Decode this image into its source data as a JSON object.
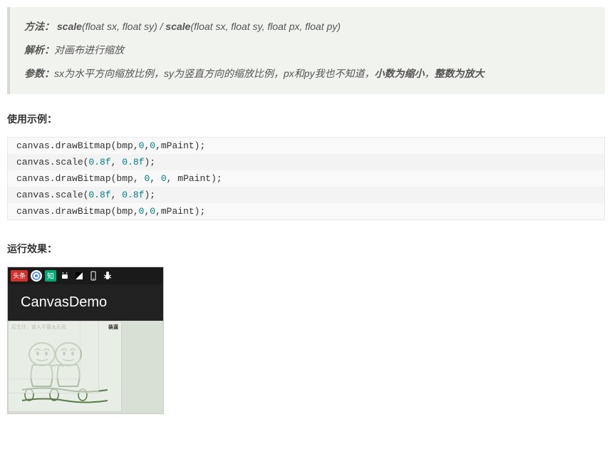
{
  "info_box": {
    "method_label": "方法",
    "method_sig_1": "scale",
    "method_params_1": "(float sx, float sy)",
    "method_separator": " / ",
    "method_sig_2": "scale",
    "method_params_2": "(float sx, float sy, float px, float py)",
    "analysis_label": "解析",
    "analysis_text": "对画布进行缩放",
    "params_label": "参数",
    "params_text": "sx为水平方向缩放比例，sy为竖直方向的缩放比例，px和py我也不知道，",
    "params_bold_1": "小数为缩小",
    "params_sep": "，",
    "params_bold_2": "整数为放大"
  },
  "sections": {
    "example_header": "使用示例",
    "result_header": "运行效果"
  },
  "code_lines": [
    "canvas.drawBitmap(bmp,0,0,mPaint);",
    "canvas.scale(0.8f, 0.8f);",
    "canvas.drawBitmap(bmp, 0, 0, mPaint);",
    "canvas.scale(0.8f, 0.8f);",
    "canvas.drawBitmap(bmp,0,0,mPaint);"
  ],
  "screenshot": {
    "status_badge": "头条",
    "status_zhi": "知",
    "app_title": "CanvasDemo",
    "meme_text_left": "后生仔，做人不要太乐观",
    "meme_text_right": "装逼"
  }
}
